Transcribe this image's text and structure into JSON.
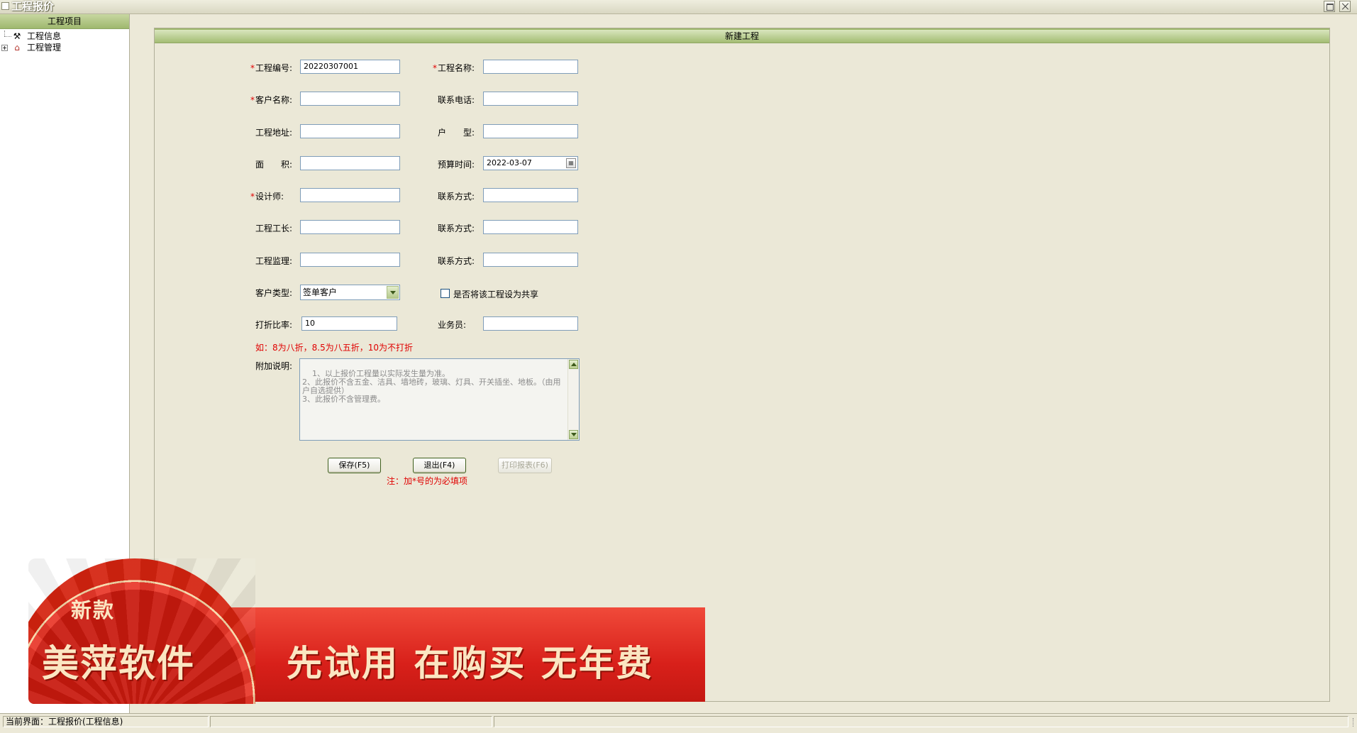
{
  "window": {
    "title": "工程报价"
  },
  "sidebar": {
    "header": "工程项目",
    "items": [
      {
        "label": "工程信息",
        "icon": "tools-icon"
      },
      {
        "label": "工程管理",
        "icon": "house-icon"
      }
    ]
  },
  "form": {
    "header": "新建工程",
    "fields": {
      "project_no": {
        "label": "工程编号:",
        "value": "20220307001",
        "required": true
      },
      "project_name": {
        "label": "工程名称:",
        "value": "",
        "required": true
      },
      "customer_name": {
        "label": "客户名称:",
        "value": "",
        "required": true
      },
      "phone": {
        "label": "联系电话:",
        "value": ""
      },
      "address": {
        "label": "工程地址:",
        "value": ""
      },
      "house_type": {
        "label": "户　　型:",
        "value": ""
      },
      "area": {
        "label": "面　　积:",
        "value": ""
      },
      "budget_time": {
        "label": "预算时间:",
        "value": "2022-03-07"
      },
      "designer": {
        "label": "设计师:",
        "value": "",
        "required": true
      },
      "designer_contact": {
        "label": "联系方式:",
        "value": ""
      },
      "foreman": {
        "label": "工程工长:",
        "value": ""
      },
      "foreman_contact": {
        "label": "联系方式:",
        "value": ""
      },
      "supervisor": {
        "label": "工程监理:",
        "value": ""
      },
      "supervisor_contact": {
        "label": "联系方式:",
        "value": ""
      },
      "customer_type": {
        "label": "客户类型:",
        "value": "签单客户"
      },
      "share": {
        "label": "是否将该工程设为共享",
        "checked": false
      },
      "discount": {
        "label": "打折比率:",
        "value": "10"
      },
      "salesman": {
        "label": "业务员:",
        "value": ""
      },
      "discount_hint": "如：8为八折，8.5为八五折，10为不打折",
      "notes": {
        "label": "附加说明:",
        "value": "1、以上报价工程量以实际发生量为准。\n2、此报价不含五金、洁具、墙地砖，玻璃、灯具、开关插坐、地板。（由用户自选提供）\n3、此报价不含管理费。"
      }
    },
    "buttons": {
      "save": "保存(F5)",
      "exit": "退出(F4)",
      "print": "打印报表(F6)"
    },
    "required_note": "注：加*号的为必填项"
  },
  "banner": {
    "tag": "新款",
    "brand": "美萍软件",
    "slogan": "先试用 在购买 无年费"
  },
  "statusbar": {
    "current": "当前界面：工程报价(工程信息)"
  }
}
